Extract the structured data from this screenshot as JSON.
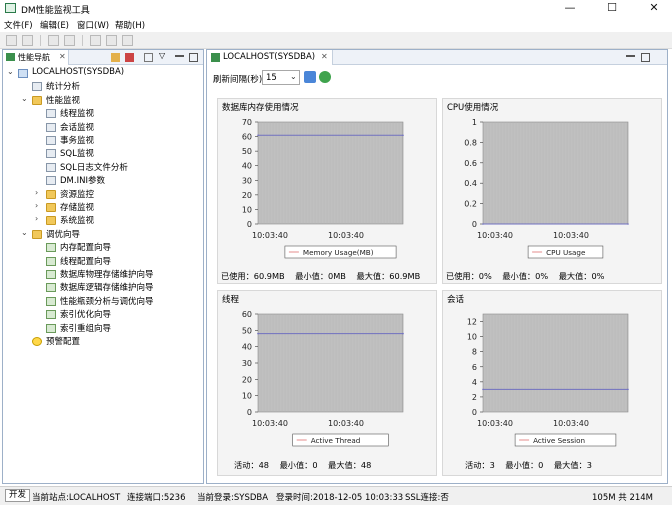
{
  "window": {
    "title": "DM性能监视工具",
    "min": "—",
    "max": "☐",
    "close": "✕"
  },
  "menu": [
    "文件(F)",
    "编辑(E)",
    "窗口(W)",
    "帮助(H)"
  ],
  "left": {
    "tab_label": "性能导航",
    "tree": [
      {
        "label": "LOCALHOST(SYSDBA)",
        "level": 0,
        "twisty": "⌄",
        "icon": "db-icon"
      },
      {
        "label": "统计分析",
        "level": 1,
        "twisty": "",
        "icon": "stats-icon"
      },
      {
        "label": "性能监视",
        "level": 1,
        "twisty": "⌄",
        "icon": "folder-icon"
      },
      {
        "label": "线程监视",
        "level": 2,
        "twisty": "",
        "icon": "thread-icon"
      },
      {
        "label": "会话监视",
        "level": 2,
        "twisty": "",
        "icon": "session-icon"
      },
      {
        "label": "事务监视",
        "level": 2,
        "twisty": "",
        "icon": "transaction-icon"
      },
      {
        "label": "SQL监视",
        "level": 2,
        "twisty": "",
        "icon": "sql-icon"
      },
      {
        "label": "SQL日志文件分析",
        "level": 2,
        "twisty": "",
        "icon": "log-icon"
      },
      {
        "label": "DM.INI参数",
        "level": 2,
        "twisty": "",
        "icon": "ini-icon"
      },
      {
        "label": "资源监控",
        "level": 2,
        "twisty": "›",
        "icon": "folder-icon"
      },
      {
        "label": "存储监视",
        "level": 2,
        "twisty": "›",
        "icon": "folder-icon"
      },
      {
        "label": "系统监视",
        "level": 2,
        "twisty": "›",
        "icon": "folder-icon"
      },
      {
        "label": "调优向导",
        "level": 1,
        "twisty": "⌄",
        "icon": "folder-icon"
      },
      {
        "label": "内存配置向导",
        "level": 2,
        "twisty": "",
        "icon": "wizard-icon"
      },
      {
        "label": "线程配置向导",
        "level": 2,
        "twisty": "",
        "icon": "wizard-icon"
      },
      {
        "label": "数据库物理存储维护向导",
        "level": 2,
        "twisty": "",
        "icon": "wizard-icon"
      },
      {
        "label": "数据库逻辑存储维护向导",
        "level": 2,
        "twisty": "",
        "icon": "wizard-icon"
      },
      {
        "label": "性能瓶颈分析与调优向导",
        "level": 2,
        "twisty": "",
        "icon": "wizard-icon"
      },
      {
        "label": "索引优化向导",
        "level": 2,
        "twisty": "",
        "icon": "wizard-icon"
      },
      {
        "label": "索引重组向导",
        "level": 2,
        "twisty": "",
        "icon": "wizard-icon"
      },
      {
        "label": "预警配置",
        "level": 1,
        "twisty": "",
        "icon": "warning-icon"
      }
    ]
  },
  "right": {
    "tab_label": "LOCALHOST(SYSDBA)",
    "refresh_label": "刷新间隔(秒)",
    "refresh_value": "15"
  },
  "chart_data": [
    {
      "type": "line",
      "title": "数据库内存使用情况",
      "series": [
        {
          "name": "Memory Usage(MB)",
          "values": [
            60.9,
            60.9
          ]
        }
      ],
      "x": [
        "10:03:40",
        "10:03:40"
      ],
      "ylim": [
        0,
        70
      ],
      "yticks": [
        0,
        10,
        20,
        30,
        40,
        50,
        60,
        70
      ],
      "grid": true,
      "legend": "bottom",
      "footer": [
        "已使用：60.9MB",
        "最小值：0MB",
        "最大值：60.9MB"
      ]
    },
    {
      "type": "line",
      "title": "CPU使用情况",
      "series": [
        {
          "name": "CPU Usage",
          "values": [
            0,
            0
          ]
        }
      ],
      "x": [
        "10:03:40",
        "10:03:40"
      ],
      "ylim": [
        0,
        1
      ],
      "yticks": [
        0,
        0.2,
        0.4,
        0.6,
        0.8,
        1
      ],
      "grid": true,
      "legend": "bottom",
      "footer": [
        "已使用：0%",
        "最小值：0%",
        "最大值：0%"
      ]
    },
    {
      "type": "line",
      "title": "线程",
      "series": [
        {
          "name": "Active Thread",
          "values": [
            48,
            48
          ]
        }
      ],
      "x": [
        "10:03:40",
        "10:03:40"
      ],
      "ylim": [
        0,
        60
      ],
      "yticks": [
        0,
        10,
        20,
        30,
        40,
        50,
        60
      ],
      "grid": true,
      "legend": "bottom",
      "footer": [
        "活动：48",
        "最小值：0",
        "最大值：48"
      ]
    },
    {
      "type": "line",
      "title": "会话",
      "series": [
        {
          "name": "Active Session",
          "values": [
            3,
            3
          ]
        }
      ],
      "x": [
        "10:03:40",
        "10:03:40"
      ],
      "ylim": [
        0,
        13
      ],
      "yticks": [
        0,
        2,
        4,
        6,
        8,
        10,
        12
      ],
      "grid": true,
      "legend": "bottom",
      "footer": [
        "活动：3",
        "最小值：0",
        "最大值：3"
      ]
    }
  ],
  "status": {
    "open": "开发",
    "site": "当前站点:LOCALHOST",
    "port": "连接端口:5236",
    "login": "当前登录:SYSDBA",
    "login_time": "登录时间:2018-12-05 10:03:33",
    "ssl": "SSL连接:否",
    "memory": "105M 共 214M"
  },
  "colors": {
    "accent": "#9db0c8",
    "plot_bg": "#c0c0c0",
    "series_line": "#e8a0a0"
  }
}
